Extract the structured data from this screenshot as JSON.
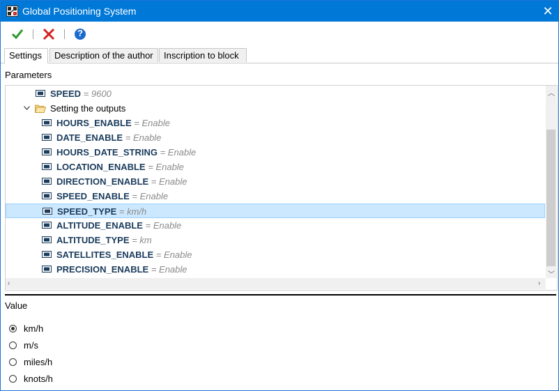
{
  "window": {
    "title": "Global Positioning System",
    "close_glyph": "✕"
  },
  "toolbar": {
    "ok_icon": "check-icon",
    "cancel_icon": "x-icon",
    "help_icon": "help-icon",
    "help_glyph": "?",
    "colors": {
      "ok": "#2e9b2e",
      "cancel": "#d42020",
      "help": "#1a6bd0"
    }
  },
  "tabs": [
    {
      "label": "Settings",
      "active": true
    },
    {
      "label": "Description of the author",
      "active": false
    },
    {
      "label": "Inscription to block",
      "active": false
    }
  ],
  "parameters_label": "Parameters",
  "tree": {
    "top_item": {
      "name": "SPEED",
      "sep": " = ",
      "value": "9600"
    },
    "folder": {
      "label": "Setting the outputs",
      "expanded": true
    },
    "items": [
      {
        "name": "HOURS_ENABLE",
        "sep": " = ",
        "value": "Enable"
      },
      {
        "name": "DATE_ENABLE",
        "sep": " = ",
        "value": "Enable"
      },
      {
        "name": "HOURS_DATE_STRING",
        "sep": " = ",
        "value": "Enable"
      },
      {
        "name": "LOCATION_ENABLE",
        "sep": " = ",
        "value": "Enable"
      },
      {
        "name": "DIRECTION_ENABLE",
        "sep": " = ",
        "value": "Enable"
      },
      {
        "name": "SPEED_ENABLE",
        "sep": " = ",
        "value": "Enable"
      },
      {
        "name": "SPEED_TYPE",
        "sep": " = ",
        "value": "km/h",
        "selected": true
      },
      {
        "name": "ALTITUDE_ENABLE",
        "sep": " = ",
        "value": "Enable"
      },
      {
        "name": "ALTITUDE_TYPE",
        "sep": " = ",
        "value": "km"
      },
      {
        "name": "SATELLITES_ENABLE",
        "sep": " = ",
        "value": "Enable"
      },
      {
        "name": "PRECISION_ENABLE",
        "sep": " = ",
        "value": "Enable"
      }
    ],
    "selection_color": "#cce8ff"
  },
  "value_label": "Value",
  "options": [
    {
      "label": "km/h",
      "checked": true
    },
    {
      "label": "m/s",
      "checked": false
    },
    {
      "label": "miles/h",
      "checked": false
    },
    {
      "label": "knots/h",
      "checked": false
    }
  ]
}
